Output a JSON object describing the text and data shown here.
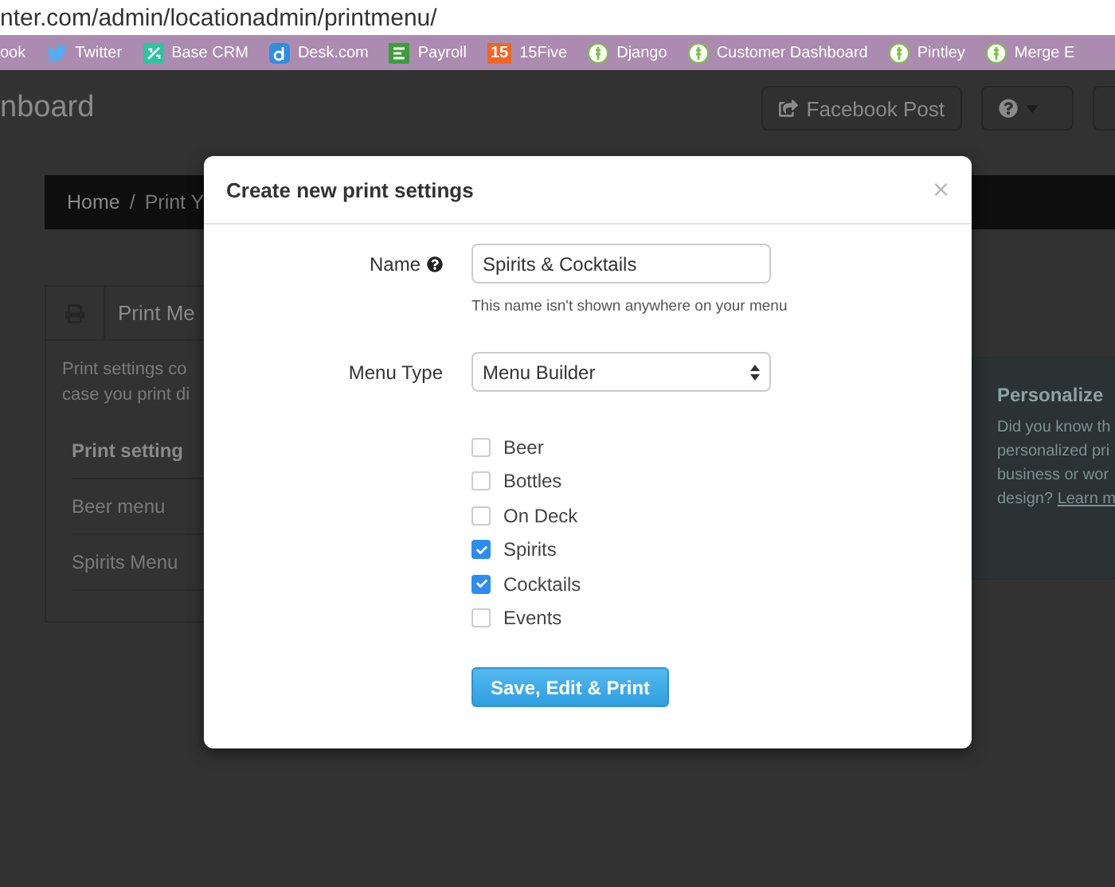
{
  "browser": {
    "url": "nter.com/admin/locationadmin/printmenu/"
  },
  "bookmarks": [
    {
      "label": "ook",
      "kind": "none"
    },
    {
      "label": "Twitter",
      "kind": "bird"
    },
    {
      "label": "Base CRM",
      "kind": "basecrm"
    },
    {
      "label": "Desk.com",
      "kind": "desk"
    },
    {
      "label": "Payroll",
      "kind": "payroll"
    },
    {
      "label": "15Five",
      "kind": "badge",
      "badge": "15"
    },
    {
      "label": "Django",
      "kind": "leaf"
    },
    {
      "label": "Customer Dashboard",
      "kind": "leaf"
    },
    {
      "label": "Pintley",
      "kind": "leaf"
    },
    {
      "label": "Merge E",
      "kind": "leaf"
    }
  ],
  "page": {
    "title": "nboard",
    "facebook_button": "Facebook Post",
    "breadcrumb": {
      "home": "Home",
      "separator": "/",
      "current": "Print Y"
    },
    "panel": {
      "title": "Print Me",
      "description": [
        "Print settings co",
        "case you print di"
      ],
      "table": {
        "columns": [
          "Print setting"
        ],
        "rows": [
          "Beer menu",
          "Spirits Menu"
        ]
      }
    },
    "promo": {
      "title": "Personalize",
      "lines": [
        "Did you know th",
        "personalized pri",
        "business or wor"
      ],
      "last_line": "design?",
      "link": "Learn m"
    }
  },
  "modal": {
    "title": "Create new print settings",
    "close": "×",
    "name_label": "Name",
    "name_value": "Spirits & Cocktails",
    "name_help": "This name isn't shown anywhere on your menu",
    "type_label": "Menu Type",
    "type_value": "Menu Builder",
    "options": [
      {
        "label": "Beer",
        "checked": false
      },
      {
        "label": "Bottles",
        "checked": false
      },
      {
        "label": "On Deck",
        "checked": false
      },
      {
        "label": "Spirits",
        "checked": true
      },
      {
        "label": "Cocktails",
        "checked": true
      },
      {
        "label": "Events",
        "checked": false
      }
    ],
    "submit": "Save, Edit & Print"
  }
}
